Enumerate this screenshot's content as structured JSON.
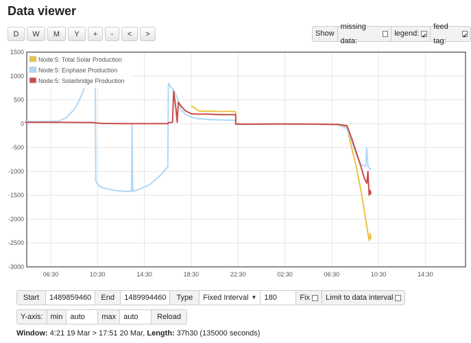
{
  "header": {
    "title": "Data viewer"
  },
  "toolbar": {
    "buttons": [
      "D",
      "W",
      "M",
      "Y",
      "+",
      "-",
      "<",
      ">"
    ]
  },
  "options": {
    "show_label": "Show",
    "missing_data_label": "missing data:",
    "missing_data_checked": false,
    "legend_label": "legend:",
    "legend_checked": true,
    "feed_tag_label": "feed tag:",
    "feed_tag_checked": true
  },
  "chart_data": {
    "type": "line",
    "x_ticks": [
      "06:30",
      "10:30",
      "14:30",
      "18:30",
      "22:30",
      "02:30",
      "06:30",
      "10:30",
      "14:30"
    ],
    "y_ticks": [
      1500,
      1000,
      500,
      0,
      -500,
      -1000,
      -1500,
      -2000,
      -2500,
      -3000
    ],
    "ylim": [
      -3000,
      1500
    ],
    "grid": true,
    "legend_position": "top-left",
    "series": [
      {
        "name": "Node:5: Total Solar Production",
        "color": "#edc240",
        "points": [
          [
            18.5,
            380
          ],
          [
            18.9,
            310
          ],
          [
            19.2,
            260
          ],
          [
            20,
            265
          ],
          [
            21,
            255
          ],
          [
            22,
            260
          ],
          [
            22.3,
            250
          ],
          [
            22.3,
            0
          ],
          [
            23,
            -10
          ],
          [
            2,
            -5
          ],
          [
            5,
            -10
          ],
          [
            7,
            -20
          ],
          [
            7.8,
            -60
          ],
          [
            8.2,
            -500
          ],
          [
            8.6,
            -900
          ],
          [
            9,
            -1400
          ],
          [
            9.4,
            -2000
          ],
          [
            9.7,
            -2450
          ],
          [
            9.8,
            -2300
          ],
          [
            9.85,
            -2420
          ]
        ]
      },
      {
        "name": "Node:5: Enphase Production",
        "color": "#afd8f8",
        "points": [
          [
            4.3,
            50
          ],
          [
            5.5,
            45
          ],
          [
            6.5,
            50
          ],
          [
            7.2,
            55
          ],
          [
            7.4,
            80
          ],
          [
            7.8,
            120
          ],
          [
            8.2,
            220
          ],
          [
            8.5,
            300
          ],
          [
            8.9,
            470
          ],
          [
            9.3,
            700
          ],
          [
            9.6,
            900
          ],
          [
            9.8,
            1050
          ],
          [
            10,
            1150
          ],
          [
            10.3,
            1100
          ],
          [
            10.35,
            -1200
          ],
          [
            10.6,
            -1300
          ],
          [
            11,
            -1350
          ],
          [
            12,
            -1400
          ],
          [
            13,
            -1420
          ],
          [
            13.4,
            -1410
          ],
          [
            13.45,
            -5
          ],
          [
            13.5,
            -1420
          ],
          [
            14,
            -1380
          ],
          [
            15,
            -1270
          ],
          [
            16,
            -1050
          ],
          [
            16.5,
            -900
          ],
          [
            16.55,
            850
          ],
          [
            16.8,
            760
          ],
          [
            17,
            700
          ],
          [
            17.3,
            550
          ],
          [
            17.6,
            300
          ],
          [
            18,
            200
          ],
          [
            18.6,
            130
          ],
          [
            19,
            110
          ],
          [
            20,
            90
          ],
          [
            21,
            80
          ],
          [
            22.3,
            70
          ],
          [
            22.3,
            -20
          ],
          [
            23,
            -10
          ],
          [
            2,
            -5
          ],
          [
            5,
            -10
          ],
          [
            7,
            -20
          ],
          [
            7.8,
            -100
          ],
          [
            8.2,
            -350
          ],
          [
            8.6,
            -650
          ],
          [
            9,
            -850
          ],
          [
            9.4,
            -900
          ],
          [
            9.5,
            -500
          ],
          [
            9.6,
            -900
          ],
          [
            9.8,
            -960
          ],
          [
            9.85,
            -940
          ]
        ]
      },
      {
        "name": "Node:5: Solarbridge Production",
        "color": "#cb4b4b",
        "points": [
          [
            4.3,
            30
          ],
          [
            6,
            30
          ],
          [
            8,
            28
          ],
          [
            10,
            25
          ],
          [
            10.4,
            15
          ],
          [
            11,
            5
          ],
          [
            13,
            0
          ],
          [
            16.5,
            0
          ],
          [
            16.55,
            20
          ],
          [
            16.9,
            30
          ],
          [
            17,
            680
          ],
          [
            17.2,
            300
          ],
          [
            17.3,
            30
          ],
          [
            17.4,
            450
          ],
          [
            17.7,
            350
          ],
          [
            18,
            270
          ],
          [
            18.5,
            210
          ],
          [
            19,
            200
          ],
          [
            20,
            200
          ],
          [
            21,
            190
          ],
          [
            22.3,
            190
          ],
          [
            22.3,
            -5
          ],
          [
            23,
            -10
          ],
          [
            2,
            -5
          ],
          [
            5,
            -8
          ],
          [
            7,
            -15
          ],
          [
            7.8,
            -40
          ],
          [
            8.2,
            -300
          ],
          [
            8.6,
            -600
          ],
          [
            9,
            -900
          ],
          [
            9.3,
            -1150
          ],
          [
            9.5,
            -1250
          ],
          [
            9.6,
            -1000
          ],
          [
            9.7,
            -1500
          ],
          [
            9.8,
            -1400
          ],
          [
            9.85,
            -1480
          ]
        ]
      }
    ]
  },
  "controls": {
    "start_label": "Start",
    "start_value": "1489859460",
    "end_label": "End",
    "end_value": "1489994460",
    "type_label": "Type",
    "type_value": "Fixed Interval",
    "interval_value": "180",
    "fix_label": "Fix",
    "limit_label": "Limit to data interval",
    "yaxis_label": "Y-axis:",
    "min_label": "min",
    "min_value": "auto",
    "max_label": "max",
    "max_value": "auto",
    "reload_label": "Reload"
  },
  "window_info": {
    "window_label": "Window:",
    "window_value": "4:21 19 Mar > 17:51 20 Mar,",
    "length_label": "Length:",
    "length_value": "37h30 (135000 seconds)"
  }
}
